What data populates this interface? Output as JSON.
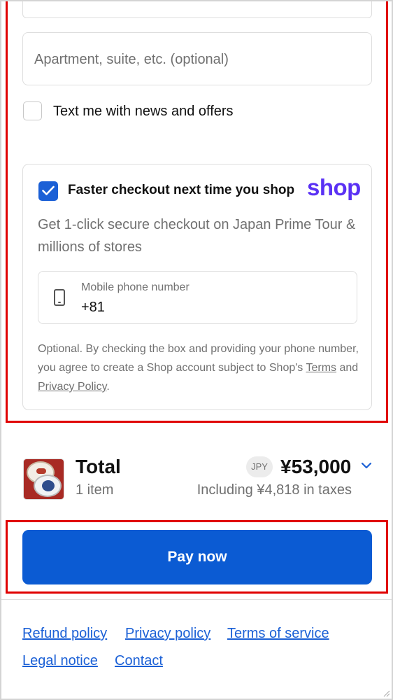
{
  "address": {
    "apartment_placeholder": "Apartment, suite, etc. (optional)"
  },
  "marketing": {
    "text_me_label": "Text me with news and offers",
    "checked": false
  },
  "shop_pay": {
    "checked": true,
    "title": "Faster checkout next time you shop",
    "logo_text": "shop",
    "description": "Get 1-click secure checkout on Japan Prime Tour & millions of stores",
    "phone_label": "Mobile phone number",
    "phone_value": "+81",
    "legal_prefix": "Optional. By checking the box and providing your phone number, you agree to create a Shop account subject to Shop's ",
    "legal_terms_link": "Terms",
    "legal_and": " and ",
    "legal_privacy_link": "Privacy Policy",
    "legal_suffix": "."
  },
  "summary": {
    "total_label": "Total",
    "item_count": "1 item",
    "currency_code": "JPY",
    "total_amount": "¥53,000",
    "taxes_note": "Including ¥4,818 in taxes"
  },
  "pay_button": {
    "label": "Pay now"
  },
  "footer": {
    "links": [
      "Refund policy",
      "Privacy policy",
      "Terms of service",
      "Legal notice",
      "Contact"
    ]
  },
  "colors": {
    "accent": "#0b5bd3",
    "shop_brand": "#5a31f4",
    "highlight": "#e00000",
    "link": "#1b60d6"
  }
}
